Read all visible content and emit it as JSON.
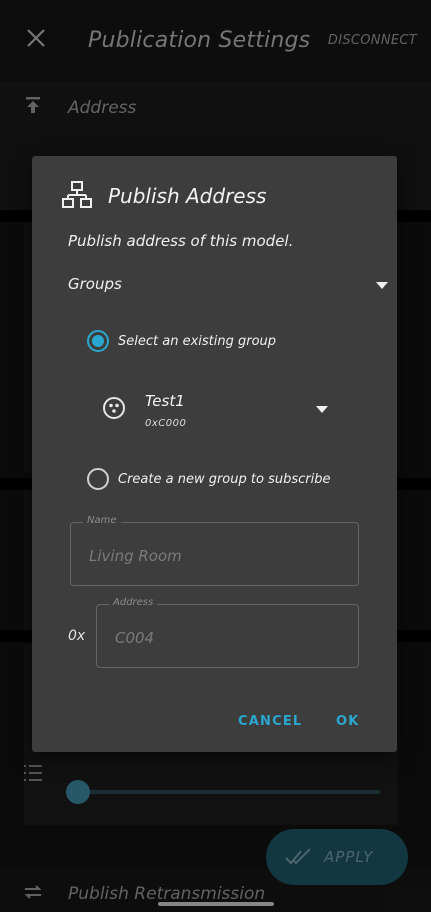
{
  "app_bar": {
    "close_icon": "close-icon",
    "title": "Publication Settings",
    "disconnect_label": "DISCONNECT"
  },
  "background": {
    "address_row": {
      "icon": "publish-icon",
      "label": "Address"
    },
    "slider_icon": "list-numbered-icon",
    "slider_value_fraction": 0.0,
    "apply_button": {
      "icon": "double-check-icon",
      "label": "APPLY"
    },
    "retransmission_row": {
      "icon": "repeat-icon",
      "label": "Publish Retransmission"
    }
  },
  "dialog": {
    "icon": "network-icon",
    "title": "Publish Address",
    "subtitle": "Publish address of this model.",
    "type_dropdown": {
      "selected": "Groups"
    },
    "options": {
      "existing": {
        "label": "Select an existing group",
        "selected": true
      },
      "create": {
        "label": "Create a new group to subscribe",
        "selected": false
      }
    },
    "group_select": {
      "icon": "group-icon",
      "name": "Test1",
      "address": "0xC000"
    },
    "name_field": {
      "label": "Name",
      "placeholder": "Living Room"
    },
    "address_field": {
      "prefix": "0x",
      "label": "Address",
      "placeholder": "C004"
    },
    "buttons": {
      "cancel": "CANCEL",
      "ok": "OK"
    },
    "accent_color": "#2aa7cf"
  }
}
